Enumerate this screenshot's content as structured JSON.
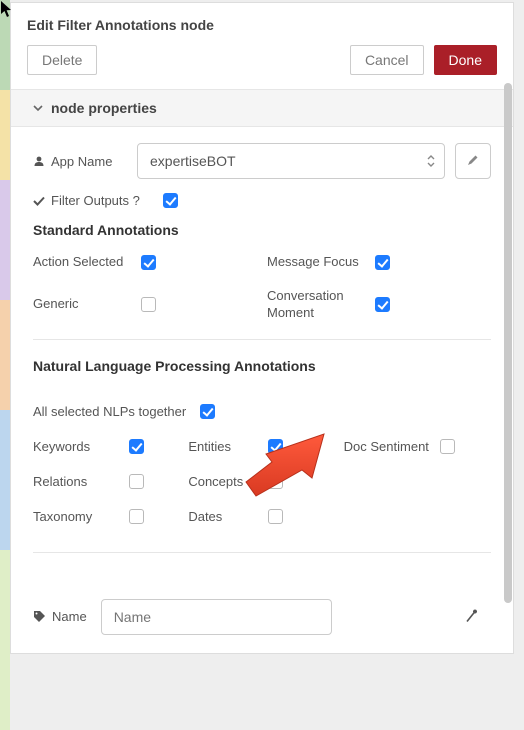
{
  "header": {
    "title": "Edit Filter Annotations node"
  },
  "buttons": {
    "delete": "Delete",
    "cancel": "Cancel",
    "done": "Done"
  },
  "section": {
    "title": "node properties"
  },
  "form": {
    "app_name_label": "App Name",
    "app_name_value": "expertiseBOT",
    "filter_outputs_label": "Filter Outputs ?",
    "filter_outputs_checked": true
  },
  "standard": {
    "title": "Standard Annotations",
    "items": [
      {
        "label": "Action Selected",
        "checked": true
      },
      {
        "label": "Message Focus",
        "checked": true
      },
      {
        "label": "Generic",
        "checked": false
      },
      {
        "label": "Conversation Moment",
        "checked": true
      }
    ]
  },
  "nlp": {
    "title": "Natural Language Processing Annotations",
    "all_label": "All selected NLPs together",
    "all_checked": true,
    "items": [
      {
        "label": "Keywords",
        "checked": true
      },
      {
        "label": "Entities",
        "checked": true
      },
      {
        "label": "Doc Sentiment",
        "checked": false
      },
      {
        "label": "Relations",
        "checked": false
      },
      {
        "label": "Concepts",
        "checked": false
      },
      {
        "label": "Taxonomy",
        "checked": false
      },
      {
        "label": "Dates",
        "checked": false
      }
    ]
  },
  "name_field": {
    "label": "Name",
    "placeholder": "Name"
  },
  "bg_colors": [
    "#9fd0a0",
    "#f5e4a0",
    "#c7b3e0",
    "#f7c59a",
    "#a9d0f4",
    "#d5e8b6"
  ]
}
